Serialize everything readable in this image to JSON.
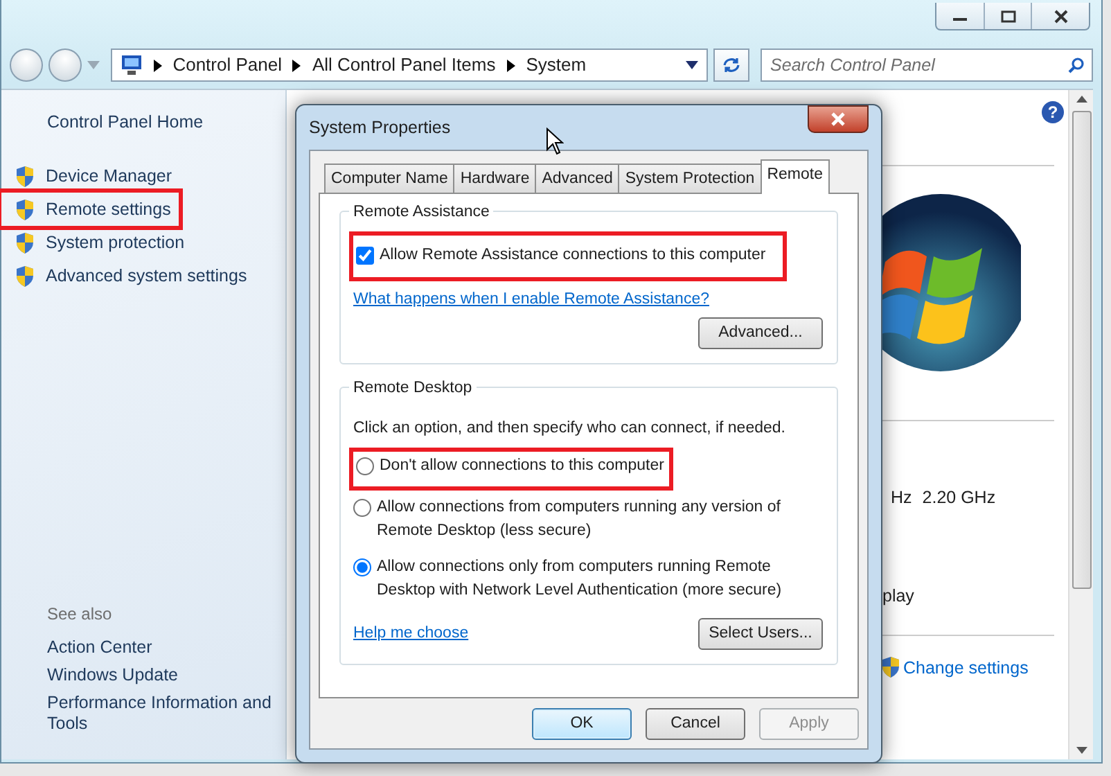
{
  "address_bar": {
    "breadcrumbs": [
      "Control Panel",
      "All Control Panel Items",
      "System"
    ]
  },
  "search": {
    "placeholder": "Search Control Panel"
  },
  "sidebar": {
    "home": "Control Panel Home",
    "tasks": [
      {
        "label": "Device Manager",
        "highlighted": false
      },
      {
        "label": "Remote settings",
        "highlighted": true
      },
      {
        "label": "System protection",
        "highlighted": false
      },
      {
        "label": "Advanced system settings",
        "highlighted": false
      }
    ],
    "see_also_title": "See also",
    "see_also": [
      "Action Center",
      "Windows Update",
      "Performance Information and Tools"
    ]
  },
  "main": {
    "help_icon": "?",
    "processor_fragment": "Hz",
    "processor_speed": "2.20 GHz",
    "display_fragment": "play",
    "change_settings": "Change settings"
  },
  "dialog": {
    "title": "System Properties",
    "tabs": [
      {
        "label": "Computer Name",
        "selected": false
      },
      {
        "label": "Hardware",
        "selected": false
      },
      {
        "label": "Advanced",
        "selected": false
      },
      {
        "label": "System Protection",
        "selected": false
      },
      {
        "label": "Remote",
        "selected": true
      }
    ],
    "remote_assistance": {
      "title": "Remote Assistance",
      "allow": {
        "label": "Allow Remote Assistance connections to this computer",
        "checked": true,
        "highlighted": true
      },
      "help_link": "What happens when I enable Remote Assistance?",
      "advanced_button": "Advanced..."
    },
    "remote_desktop": {
      "title": "Remote Desktop",
      "instruction": "Click an option, and then specify who can connect, if needed.",
      "options": [
        {
          "label": "Don't allow connections to this computer",
          "selected": false,
          "highlighted": true
        },
        {
          "label": "Allow connections from computers running any version of Remote Desktop (less secure)",
          "selected": false,
          "highlighted": false
        },
        {
          "label": "Allow connections only from computers running Remote Desktop with Network Level Authentication (more secure)",
          "selected": true,
          "highlighted": false
        }
      ],
      "help_link": "Help me choose",
      "select_users_button": "Select Users..."
    },
    "buttons": [
      {
        "label": "OK",
        "kind": "default",
        "disabled": false
      },
      {
        "label": "Cancel",
        "kind": "normal",
        "disabled": false
      },
      {
        "label": "Apply",
        "kind": "normal",
        "disabled": true
      }
    ]
  }
}
